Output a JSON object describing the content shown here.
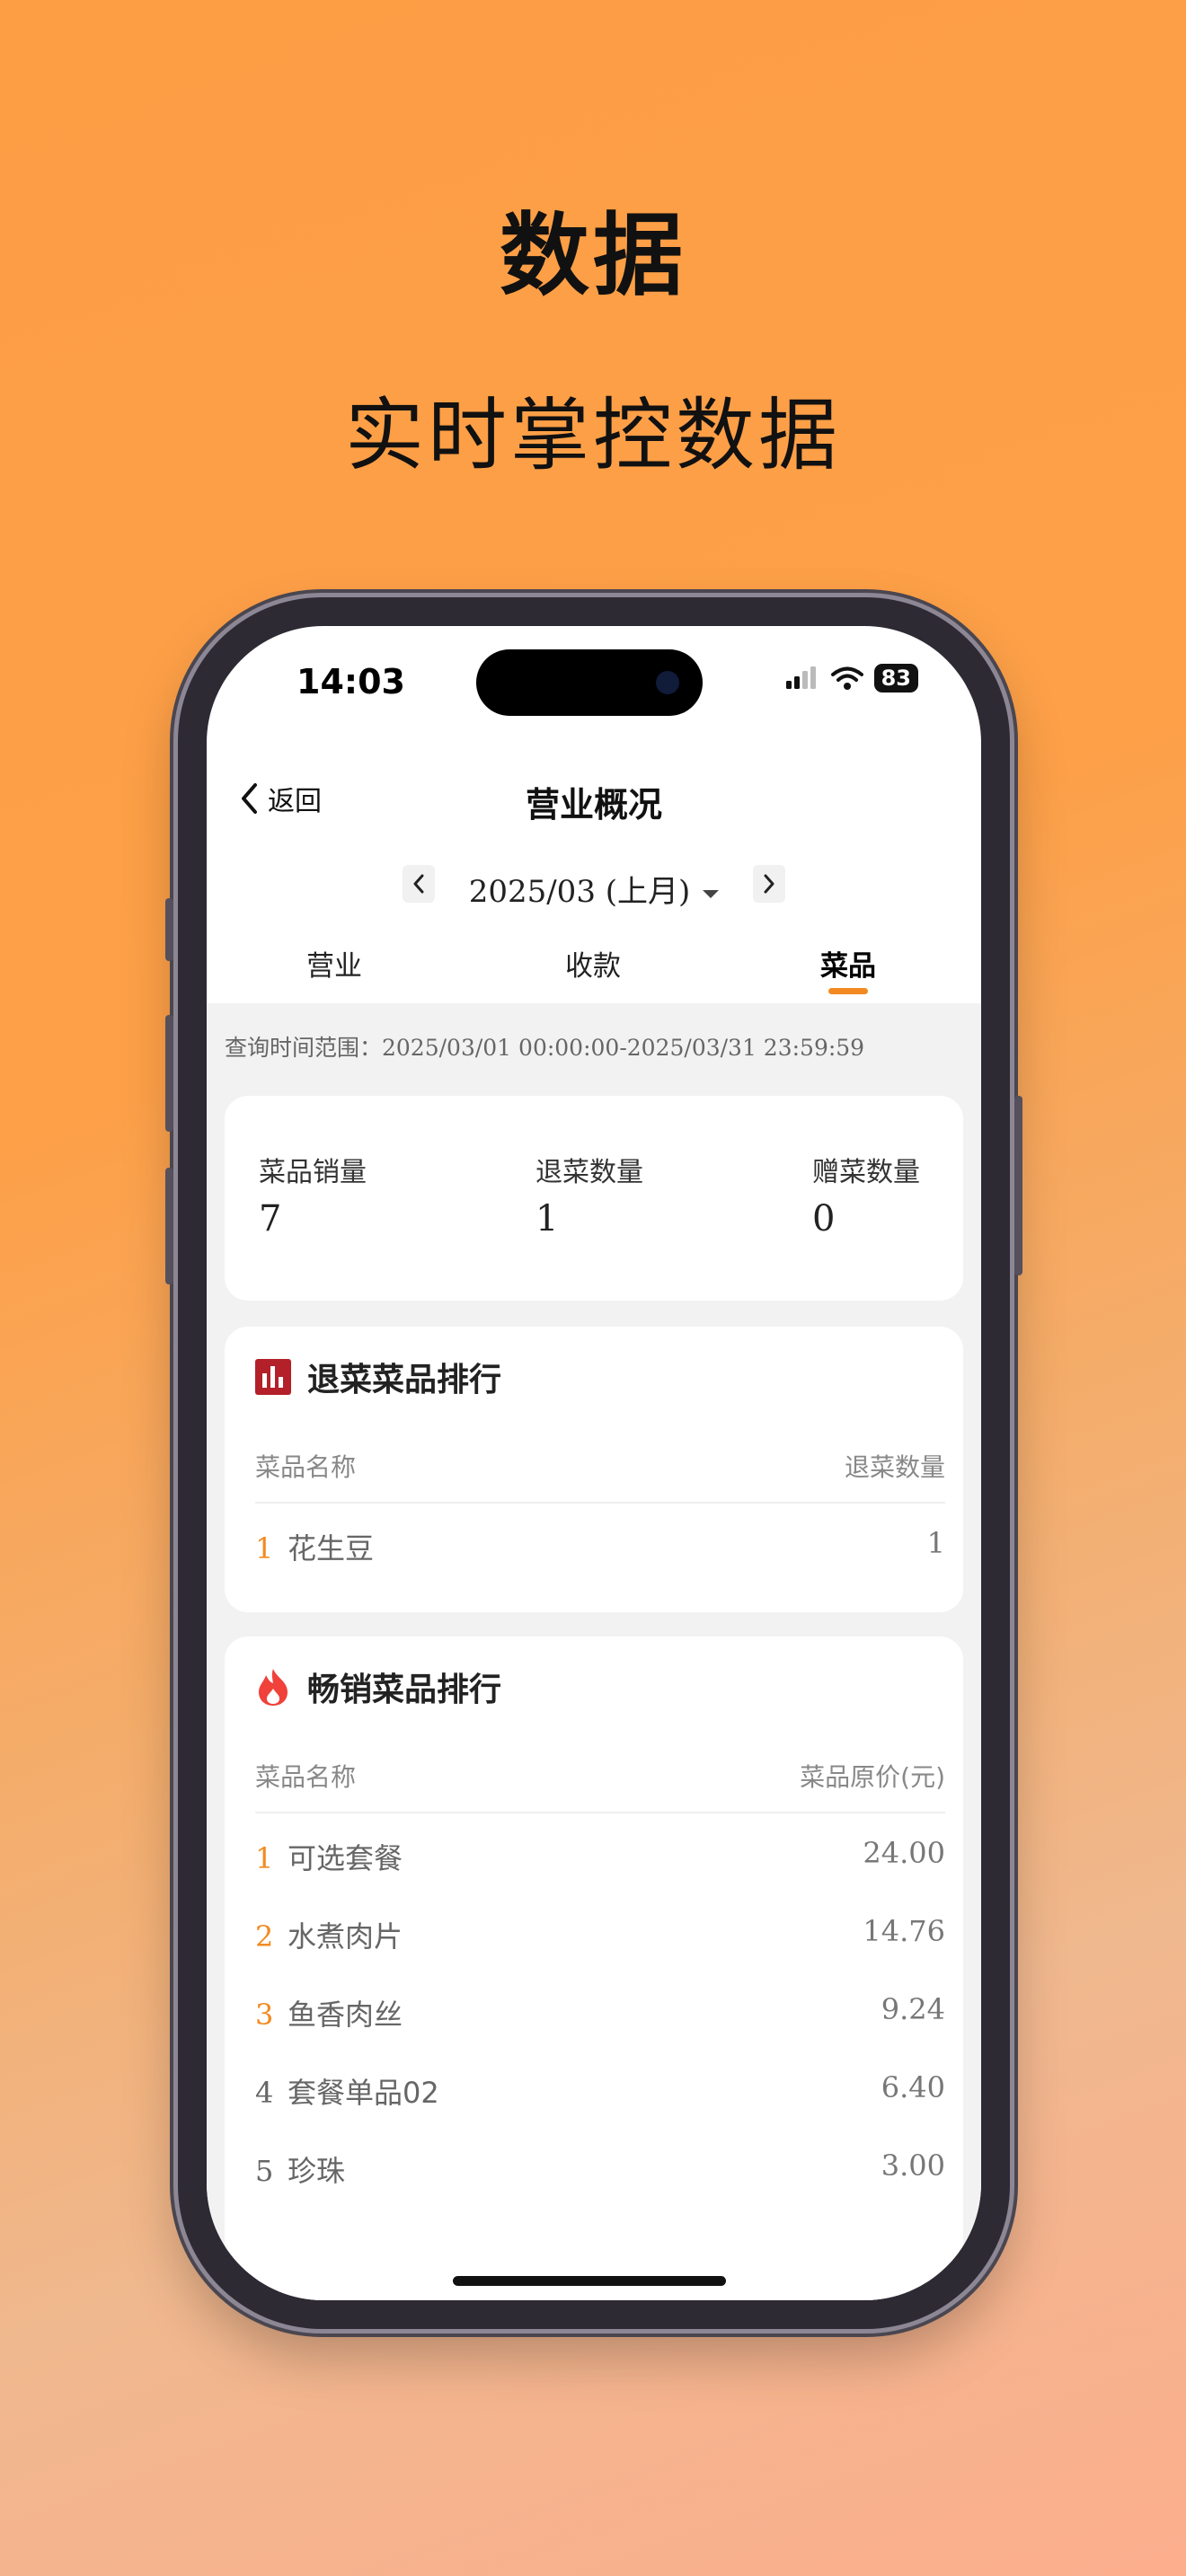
{
  "hero": {
    "title": "数据",
    "subtitle": "实时掌控数据"
  },
  "status_bar": {
    "time": "14:03",
    "battery": "83"
  },
  "nav": {
    "back_label": "返回",
    "title": "营业概况"
  },
  "date_selector": {
    "value": "2025/03 (上月)"
  },
  "tabs": [
    {
      "label": "营业",
      "active": false
    },
    {
      "label": "收款",
      "active": false
    },
    {
      "label": "菜品",
      "active": true
    }
  ],
  "query_range": "查询时间范围：2025/03/01 00:00:00-2025/03/31 23:59:59",
  "summary": [
    {
      "label": "菜品销量",
      "value": "7"
    },
    {
      "label": "退菜数量",
      "value": "1"
    },
    {
      "label": "赠菜数量",
      "value": "0"
    }
  ],
  "return_ranking": {
    "title": "退菜菜品排行",
    "icon": "bar-chart-icon",
    "col_name": "菜品名称",
    "col_value": "退菜数量",
    "rows": [
      {
        "rank": "1",
        "name": "花生豆",
        "value": "1"
      }
    ]
  },
  "bestseller_ranking": {
    "title": "畅销菜品排行",
    "icon": "flame-icon",
    "col_name": "菜品名称",
    "col_value": "菜品原价(元)",
    "rows": [
      {
        "rank": "1",
        "name": "可选套餐",
        "value": "24.00"
      },
      {
        "rank": "2",
        "name": "水煮肉片",
        "value": "14.76"
      },
      {
        "rank": "3",
        "name": "鱼香肉丝",
        "value": "9.24"
      },
      {
        "rank": "4",
        "name": "套餐单品02",
        "value": "6.40"
      },
      {
        "rank": "5",
        "name": "珍珠",
        "value": "3.00"
      }
    ]
  },
  "colors": {
    "accent": "#f28a21",
    "return_icon": "#b3202a",
    "flame_icon": "#f0413a"
  }
}
